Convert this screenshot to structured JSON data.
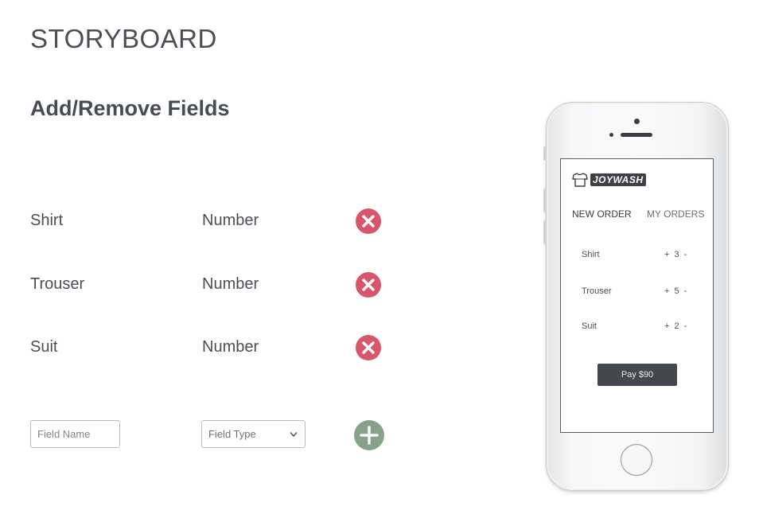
{
  "header": {
    "title": "STORYBOARD",
    "section_title": "Add/Remove Fields"
  },
  "fields": [
    {
      "name": "Shirt",
      "type": "Number"
    },
    {
      "name": "Trouser",
      "type": "Number"
    },
    {
      "name": "Suit",
      "type": "Number"
    }
  ],
  "new_field": {
    "name_placeholder": "Field Name",
    "type_selected": "Field Type"
  },
  "icons": {
    "remove": "close-circle-icon",
    "add": "plus-circle-icon",
    "dropdown": "chevron-down-icon",
    "logo": "shirt-icon"
  },
  "colors": {
    "remove": "#d8566c",
    "add": "#86a38a",
    "pay_button": "#43484f"
  },
  "phone": {
    "logo_text": "JOYWASH",
    "tabs": [
      {
        "label": "NEW ORDER",
        "active": true
      },
      {
        "label": "MY ORDERS",
        "active": false
      }
    ],
    "orders": [
      {
        "item": "Shirt",
        "plus": "+",
        "qty": "3",
        "minus": "-"
      },
      {
        "item": "Trouser",
        "plus": "+",
        "qty": "5",
        "minus": "-"
      },
      {
        "item": "Suit",
        "plus": "+",
        "qty": "2",
        "minus": "-"
      }
    ],
    "pay_label": "Pay $90"
  }
}
